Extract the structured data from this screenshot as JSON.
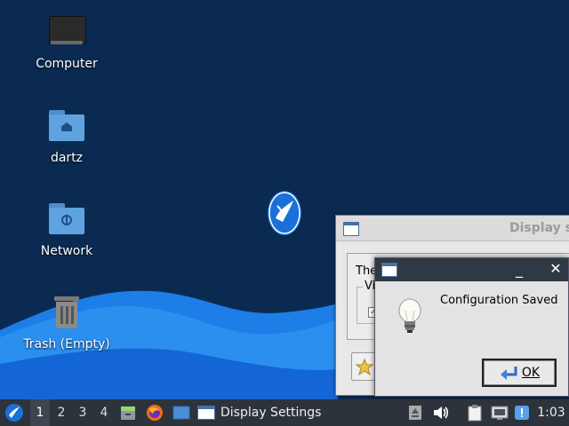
{
  "desktop": {
    "icons": [
      {
        "label": "Computer"
      },
      {
        "label": "dartz"
      },
      {
        "label": "Network"
      },
      {
        "label": "Trash (Empty)"
      }
    ]
  },
  "settings_window": {
    "title": "Display s",
    "frame_text": "The",
    "group_label": "Vir"
  },
  "dialog": {
    "minimize_glyph": "_",
    "close_glyph": "✕",
    "message": "Configuration Saved",
    "ok_label": "OK",
    "icon": "lightbulb-icon"
  },
  "taskbar": {
    "workspaces": [
      "1",
      "2",
      "3",
      "4"
    ],
    "active_workspace": "1",
    "task_label": "Display Settings",
    "clock": "1:03"
  },
  "colors": {
    "desktop_bg": "#0b2a52",
    "wave_light": "#3aa0f0",
    "wave_dark": "#1466d6",
    "taskbar_bg": "#2c333b",
    "dialog_titlebar": "#2f3944"
  }
}
